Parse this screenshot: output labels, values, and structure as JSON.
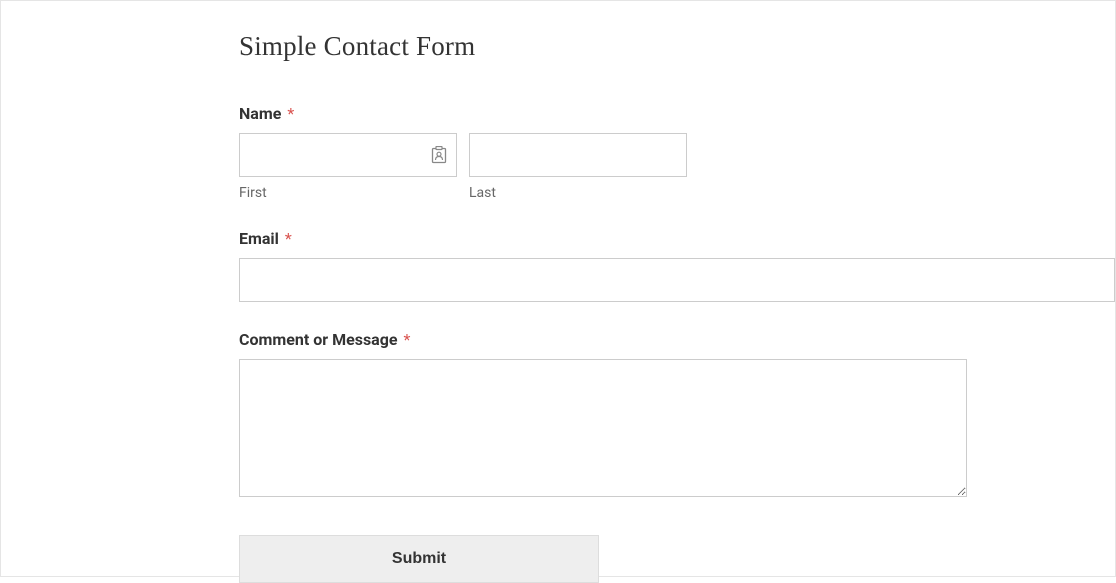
{
  "form": {
    "title": "Simple Contact Form",
    "name": {
      "label": "Name",
      "required_mark": "*",
      "first_sublabel": "First",
      "last_sublabel": "Last",
      "first_value": "",
      "last_value": ""
    },
    "email": {
      "label": "Email",
      "required_mark": "*",
      "value": ""
    },
    "message": {
      "label": "Comment or Message",
      "required_mark": "*",
      "value": ""
    },
    "submit": {
      "label": "Submit"
    }
  }
}
